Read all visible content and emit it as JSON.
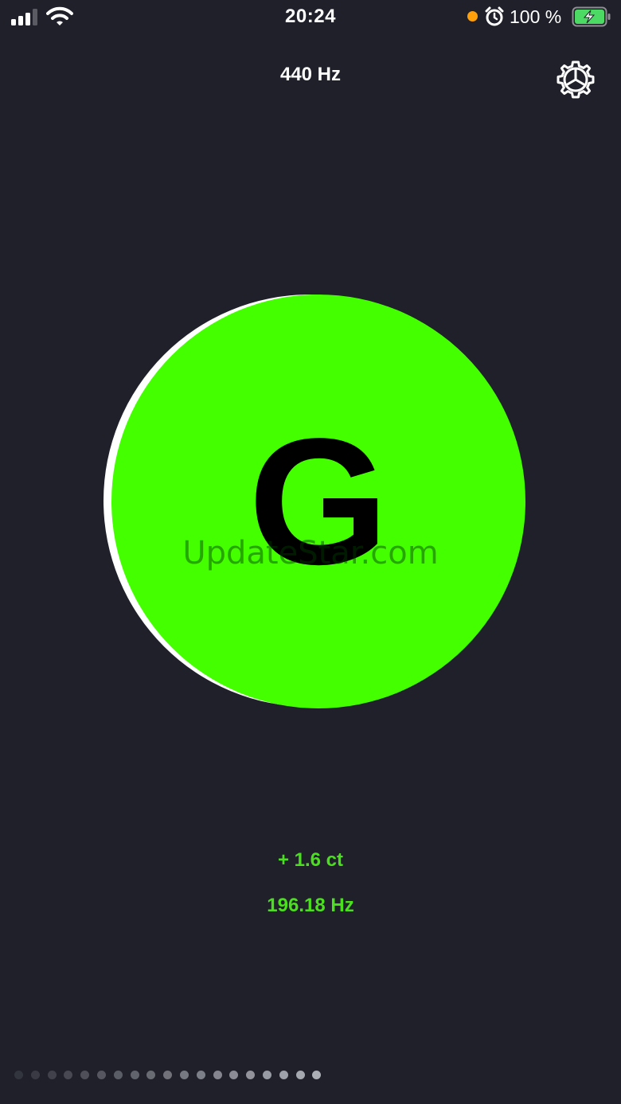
{
  "status_bar": {
    "time": "20:24",
    "battery_percent": "100 %",
    "signal_icon": "cellular-signal-icon",
    "wifi_icon": "wifi-icon",
    "alarm_icon": "alarm-clock-icon",
    "battery_icon": "battery-charging-icon",
    "indicator_color": "#ff9f0a",
    "battery_color": "#4cd964"
  },
  "header": {
    "reference_frequency": "440 Hz",
    "settings_icon": "gear-icon"
  },
  "tuner": {
    "note": "G",
    "note_color": "#44ff00",
    "cents_offset": "+ 1.6 ct",
    "detected_frequency": "196.18 Hz",
    "readout_color": "#4be01e"
  },
  "watermark": "UpdateStar.com",
  "history_dots": {
    "count": 19
  },
  "colors": {
    "background": "#1f202a"
  }
}
